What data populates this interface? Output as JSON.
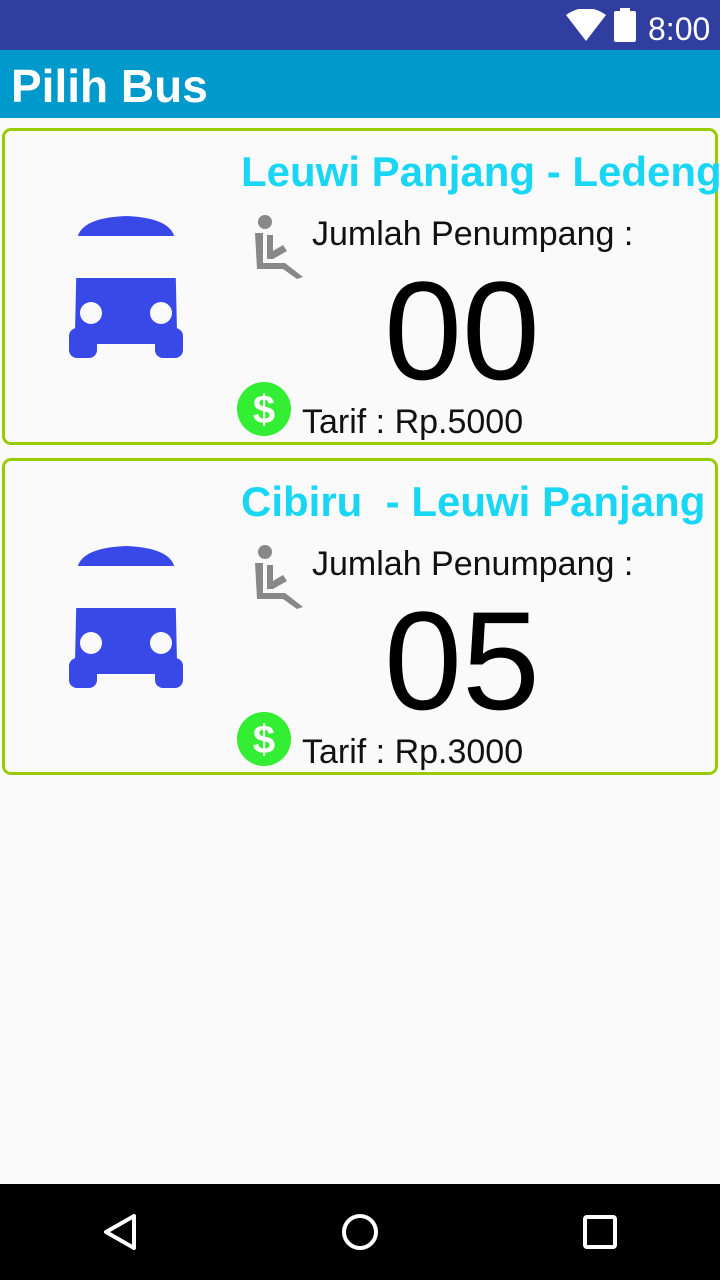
{
  "status_bar": {
    "time": "8:00",
    "icons": [
      "wifi-icon",
      "battery-icon"
    ]
  },
  "app_bar": {
    "title": "Pilih Bus"
  },
  "buses": [
    {
      "route": "Leuwi Panjang - Ledeng",
      "passenger_label": "Jumlah Penumpang :",
      "passenger_count": "00",
      "fare": "Tarif : Rp.5000"
    },
    {
      "route": "Cibiru  - Leuwi Panjang",
      "passenger_label": "Jumlah Penumpang :",
      "passenger_count": "05",
      "fare": "Tarif : Rp.3000"
    }
  ],
  "icons": {
    "bus": "bus-icon",
    "seat": "accessible-seat-icon",
    "fare": "dollar-icon"
  },
  "colors": {
    "status_bar": "#303f9f",
    "app_bar": "#0099cc",
    "card_border": "#99cc00",
    "route_text": "#1ad6f5",
    "bus_icon": "#3949e8",
    "dollar_icon": "#33ee33"
  },
  "nav_bar": {
    "buttons": [
      "back-icon",
      "home-icon",
      "recents-icon"
    ]
  }
}
